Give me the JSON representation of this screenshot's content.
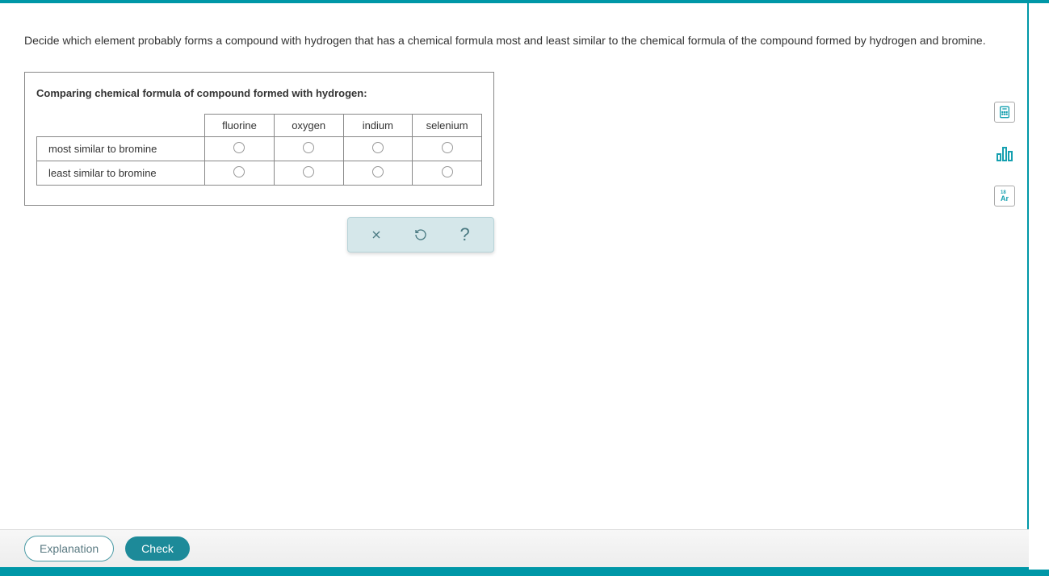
{
  "question": "Decide which element probably forms a compound with hydrogen that has a chemical formula most and least similar to the chemical formula of the compound formed by hydrogen and bromine.",
  "box": {
    "title": "Comparing chemical formula of compound formed with hydrogen:",
    "columns": [
      "fluorine",
      "oxygen",
      "indium",
      "selenium"
    ],
    "rows": [
      "most similar to bromine",
      "least similar to bromine"
    ]
  },
  "toolbar": {
    "clear": "✕",
    "reset": "↺",
    "help": "?"
  },
  "footer": {
    "explanation": "Explanation",
    "check": "Check"
  },
  "side": {
    "calculator": "calculator",
    "bars": "bars",
    "periodic": "Ar"
  }
}
